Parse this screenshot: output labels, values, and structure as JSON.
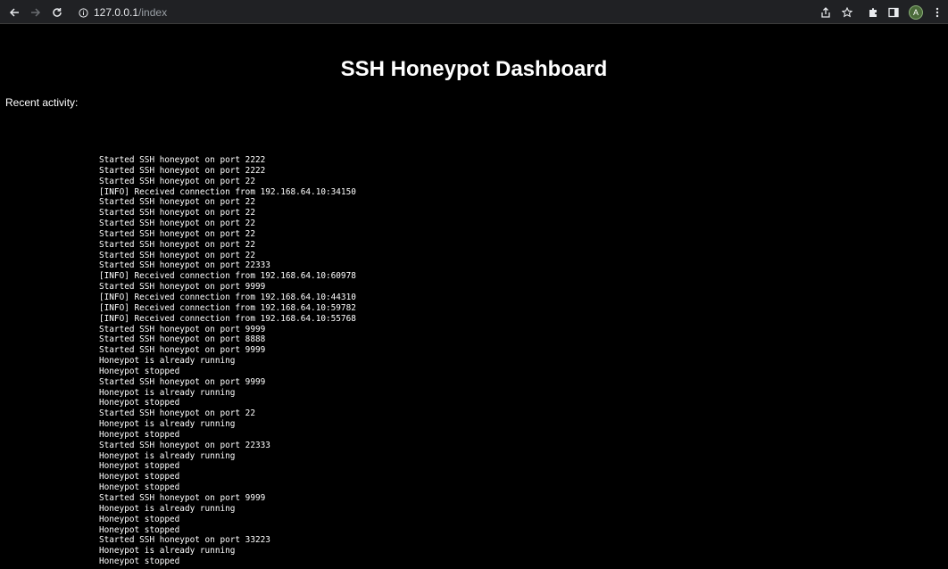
{
  "browser": {
    "url_host": "127.0.0.1",
    "url_path": "/index",
    "avatar_letter": "A"
  },
  "page": {
    "title": "SSH Honeypot Dashboard",
    "recent_label": "Recent activity:"
  },
  "log_lines": [
    "Started SSH honeypot on port 2222",
    "Started SSH honeypot on port 2222",
    "Started SSH honeypot on port 22",
    "[INFO] Received connection from 192.168.64.10:34150",
    "Started SSH honeypot on port 22",
    "Started SSH honeypot on port 22",
    "Started SSH honeypot on port 22",
    "Started SSH honeypot on port 22",
    "Started SSH honeypot on port 22",
    "Started SSH honeypot on port 22",
    "Started SSH honeypot on port 22333",
    "[INFO] Received connection from 192.168.64.10:60978",
    "Started SSH honeypot on port 9999",
    "[INFO] Received connection from 192.168.64.10:44310",
    "[INFO] Received connection from 192.168.64.10:59782",
    "[INFO] Received connection from 192.168.64.10:55768",
    "Started SSH honeypot on port 9999",
    "Started SSH honeypot on port 8888",
    "Started SSH honeypot on port 9999",
    "Honeypot is already running",
    "Honeypot stopped",
    "Started SSH honeypot on port 9999",
    "Honeypot is already running",
    "Honeypot stopped",
    "Started SSH honeypot on port 22",
    "Honeypot is already running",
    "Honeypot stopped",
    "Started SSH honeypot on port 22333",
    "Honeypot is already running",
    "Honeypot stopped",
    "Honeypot stopped",
    "Honeypot stopped",
    "Started SSH honeypot on port 9999",
    "Honeypot is already running",
    "Honeypot stopped",
    "Honeypot stopped",
    "Started SSH honeypot on port 33223",
    "Honeypot is already running",
    "Honeypot stopped"
  ]
}
